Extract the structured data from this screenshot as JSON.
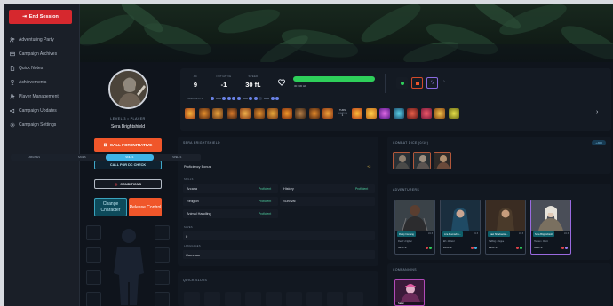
{
  "sidebar": {
    "end_session": "End Session",
    "items": [
      {
        "label": "Adventuring Party",
        "icon": "party-icon"
      },
      {
        "label": "Campaign Archives",
        "icon": "archive-icon"
      },
      {
        "label": "Quick Notes",
        "icon": "notes-icon"
      },
      {
        "label": "Achievements",
        "icon": "trophy-icon"
      },
      {
        "label": "Player Management",
        "icon": "players-icon"
      },
      {
        "label": "Campaign Updates",
        "icon": "megaphone-icon"
      },
      {
        "label": "Campaign Settings",
        "icon": "gear-icon"
      }
    ]
  },
  "character": {
    "level_line": "LEVEL 3 • PLAYER",
    "name": "Sera Brightshield",
    "call_initiative": "CALL FOR INITIATIVE",
    "call_dc": "CALL FOR DC CHECK",
    "conditions": "CONDITIONS",
    "change_line1": "Change",
    "change_line2": "Character",
    "release": "Release Control"
  },
  "stats": {
    "ac_label": "AC",
    "ac": "9",
    "init_label": "INITIATIVE",
    "init": "-1",
    "speed_label": "SPEED",
    "speed": "30 ft.",
    "hp_text": "30 / 30 HP",
    "hp_fraction": 1.0,
    "spell_slots_label": "SPELL SLOTS",
    "turn_label": "TURN",
    "turn_sub": "DURATION",
    "turn_num": "1"
  },
  "sheet": {
    "title": "SERA BRIGHTSHIELD",
    "tabs": [
      "ABILITIES",
      "SAVES",
      "SKILLS",
      "SPELLS"
    ],
    "active_tab": 2,
    "prof_bonus_label": "Proficiency Bonus",
    "prof_bonus": "+2",
    "skills_label": "SKILLS",
    "skills": [
      {
        "name": "Arcana",
        "tag": "Proficient"
      },
      {
        "name": "History",
        "tag": "Proficient"
      },
      {
        "name": "Religion",
        "tag": "Proficient"
      },
      {
        "name": "Survival",
        "tag": "Proficient"
      },
      {
        "name": "Animal Handling",
        "tag": "Proficient"
      }
    ],
    "saves_label": "SAVES",
    "saves_value": "0",
    "lang_label": "LANGUAGES",
    "lang_value": "Common"
  },
  "quick_slots": {
    "title": "QUICK SLOTS"
  },
  "combat": {
    "title": "COMBAT DICE (0/10)",
    "add": "+ ADD"
  },
  "adventurers": {
    "title": "ADVENTURERS",
    "cards": [
      {
        "name": "Rusty Ironfang",
        "lv": "LV 3",
        "cls": "Dwarf • Fighter",
        "hp": "30/30 HP"
      },
      {
        "name": "Lira Moonwhis...",
        "lv": "LV 3",
        "cls": "Elf • Wizard",
        "hp": "22/22 HP"
      },
      {
        "name": "Kael Shadowste...",
        "lv": "LV 3",
        "cls": "Halfling • Rogue",
        "hp": "24/24 HP"
      },
      {
        "name": "Sera Brightshield",
        "lv": "LV 3",
        "cls": "Human • Cleric",
        "hp": "30/30 HP"
      }
    ]
  },
  "companions": {
    "title": "COMPANIONS",
    "name": "Sakai"
  },
  "colors": {
    "accent": "#f0562a",
    "danger": "#d6282e",
    "hp": "#2ecf5a",
    "info": "#3fb3e6"
  }
}
